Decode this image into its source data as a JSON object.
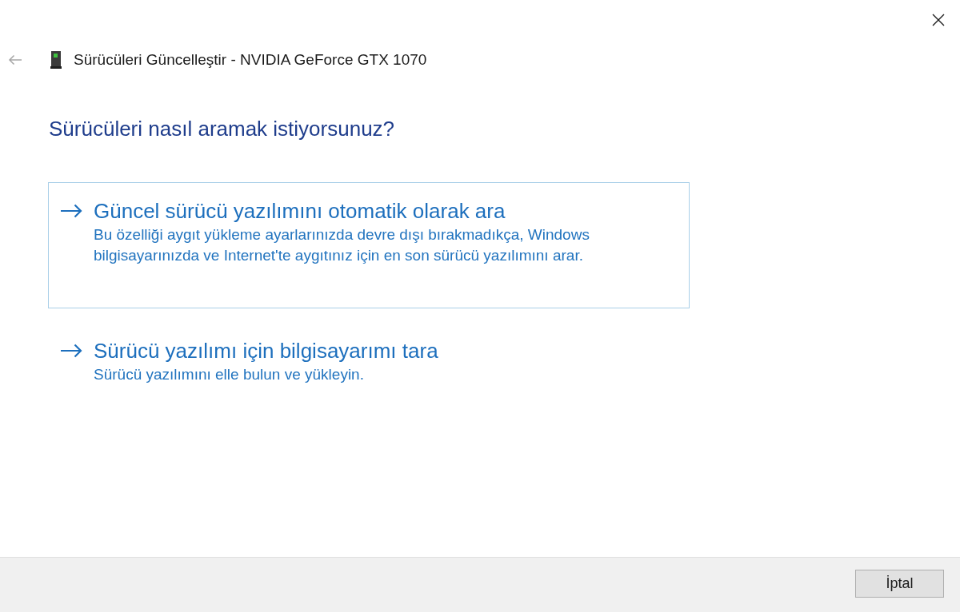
{
  "header": {
    "back_disabled": true,
    "title": "Sürücüleri Güncelleştir - NVIDIA GeForce GTX 1070"
  },
  "heading": "Sürücüleri nasıl aramak istiyorsunuz?",
  "options": [
    {
      "title": "Güncel sürücü yazılımını otomatik olarak ara",
      "description": "Bu özelliği aygıt yükleme ayarlarınızda devre dışı bırakmadıkça, Windows bilgisayarınızda ve Internet'te aygıtınız için en son sürücü yazılımını arar.",
      "highlighted": true
    },
    {
      "title": "Sürücü yazılımı için bilgisayarımı tara",
      "description": "Sürücü yazılımını elle bulun ve yükleyin.",
      "highlighted": false
    }
  ],
  "footer": {
    "buttons": [
      {
        "label": "İptal"
      }
    ]
  }
}
